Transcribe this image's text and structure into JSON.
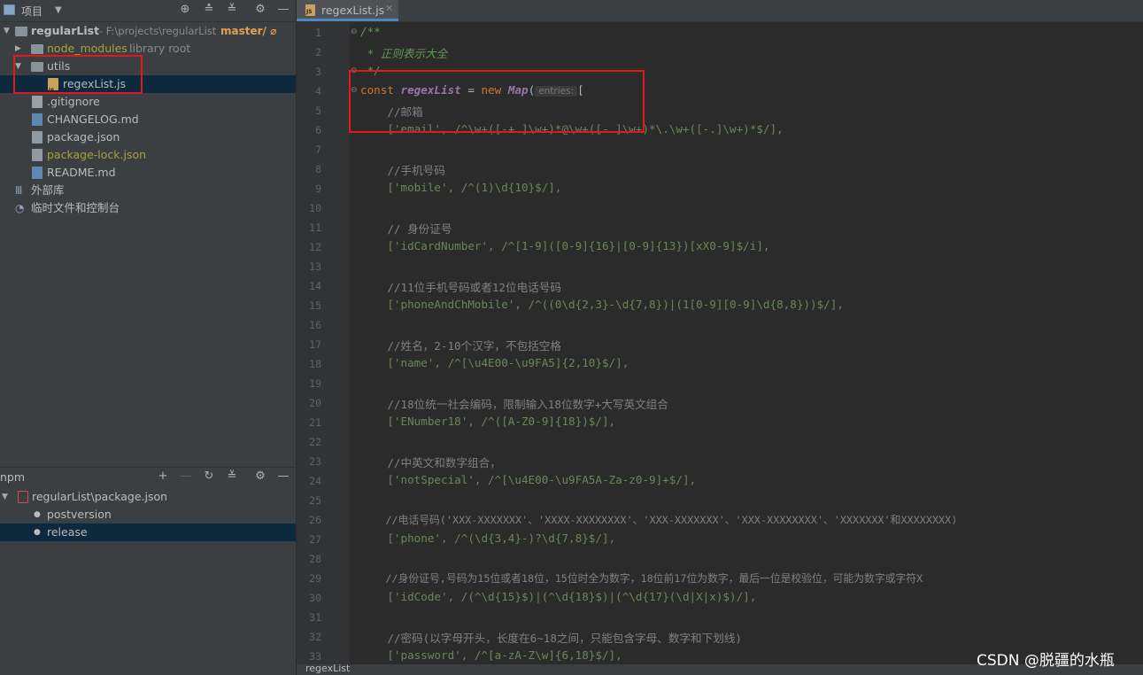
{
  "project_panel": {
    "title": "项目",
    "root": {
      "name": "regularList",
      "path": "- F:\\projects\\regularList",
      "branch": "master/ ⌀"
    },
    "items": [
      {
        "label": "node_modules",
        "extra": "library root",
        "type": "folder",
        "color": "#a7a23a"
      },
      {
        "label": "utils",
        "type": "folder",
        "color": "#bbbbbb"
      },
      {
        "label": "regexList.js",
        "type": "js",
        "color": "#bbbbbb"
      },
      {
        "label": ".gitignore",
        "type": "file",
        "color": "#bbbbbb"
      },
      {
        "label": "CHANGELOG.md",
        "type": "md",
        "color": "#bbbbbb"
      },
      {
        "label": "package.json",
        "type": "json",
        "color": "#bbbbbb"
      },
      {
        "label": "package-lock.json",
        "type": "json",
        "color": "#a7a23a"
      },
      {
        "label": "README.md",
        "type": "md",
        "color": "#bbbbbb"
      },
      {
        "label": "外部库",
        "type": "lib",
        "color": "#bbbbbb"
      },
      {
        "label": "临时文件和控制台",
        "type": "scratch",
        "color": "#bbbbbb"
      }
    ]
  },
  "npm_panel": {
    "title": "npm",
    "package": "regularList\\package.json",
    "scripts": [
      "postversion",
      "release"
    ]
  },
  "editor": {
    "tab": "regexList.js",
    "status_file": "regexList",
    "param_hint": "entries:",
    "lines": [
      "1",
      "2",
      "3",
      "4",
      "5",
      "6",
      "7",
      "8",
      "9",
      "10",
      "11",
      "12",
      "13",
      "14",
      "15",
      "16",
      "17",
      "18",
      "19",
      "20",
      "21",
      "22",
      "23",
      "24",
      "25",
      "26",
      "27",
      "28",
      "29",
      "30",
      "31",
      "32",
      "33"
    ],
    "code": {
      "l1": "/**",
      "l2": " * 正则表示大全",
      "l3": " */",
      "l4_const": "const ",
      "l4_name": "regexList",
      "l4_eq": " = ",
      "l4_new": "new ",
      "l4_map": "Map",
      "l4_open": "(",
      "l4_br": "[",
      "l5": "    //邮箱",
      "l6": "    ['email', /^\\w+([-+.]\\w+)*@\\w+([-.]\\w+)*\\.\\w+([-.]\\w+)*$/],",
      "l8": "    //手机号码",
      "l9": "    ['mobile', /^(1)\\d{10}$/],",
      "l11": "    // 身份证号",
      "l12": "    ['idCardNumber', /^[1-9]([0-9]{16}|[0-9]{13})[xX0-9]$/i],",
      "l14": "    //11位手机号码或者12位电话号码",
      "l15": "    ['phoneAndChMobile', /^((0\\d{2,3}-\\d{7,8})|(1[0-9][0-9]\\d{8,8}))$/],",
      "l17": "    //姓名，2-10个汉字，不包括空格",
      "l18": "    ['name', /^[\\u4E00-\\u9FA5]{2,10}$/],",
      "l20": "    //18位统一社会编码，限制输入18位数字+大写英文组合",
      "l21": "    ['ENumber18', /^([A-Z0-9]{18})$/],",
      "l23": "    //中英文和数字组合，",
      "l24": "    ['notSpecial', /^[\\u4E00-\\u9FA5A-Za-z0-9]+$/],",
      "l26": "    //电话号码('XXX-XXXXXXX'、'XXXX-XXXXXXXX'、'XXX-XXXXXXX'、'XXX-XXXXXXXX'、'XXXXXXX'和XXXXXXXX)",
      "l27": "    ['phone', /^(\\d{3,4}-)?\\d{7,8}$/],",
      "l29": "    //身份证号,号码为15位或者18位，15位时全为数字，18位前17位为数字，最后一位是校验位，可能为数字或字符X",
      "l30": "    ['idCode', /(^\\d{15}$)|(^\\d{18}$)|(^\\d{17}(\\d|X|x)$)/],",
      "l32": "    //密码(以字母开头，长度在6~18之间，只能包含字母、数字和下划线)",
      "l33": "    ['password', /^[a-zA-Z\\w]{6,18}$/],"
    }
  },
  "watermark": "CSDN @脱疆的水瓶",
  "colors": {
    "highlight": "#e0191c",
    "selection": "#0d293e",
    "accent": "#4a88c7"
  }
}
